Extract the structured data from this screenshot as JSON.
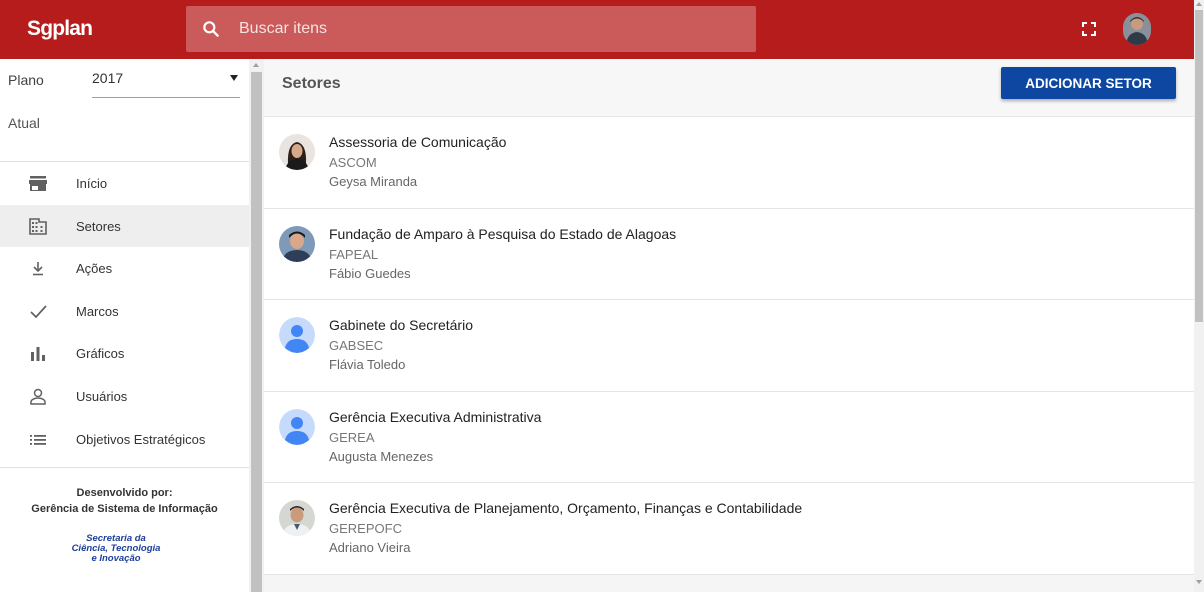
{
  "app": {
    "brand": "Sgplan"
  },
  "search": {
    "placeholder": "Buscar itens",
    "value": ""
  },
  "colors": {
    "topbar": "#b71c1c",
    "primary_button": "#0d47a1",
    "active_nav": "#eeeeee"
  },
  "icons": {
    "search": "search-icon",
    "fullscreen": "fullscreen-icon",
    "user": "user-avatar"
  },
  "sidebar": {
    "plan_label": "Plano",
    "plan_value": "2017",
    "atual_label": "Atual",
    "items": [
      {
        "label": "Início",
        "icon": "store-icon",
        "active": false
      },
      {
        "label": "Setores",
        "icon": "domain-icon",
        "active": true
      },
      {
        "label": "Ações",
        "icon": "download-icon",
        "active": false
      },
      {
        "label": "Marcos",
        "icon": "check-icon",
        "active": false
      },
      {
        "label": "Gráficos",
        "icon": "bar-chart-icon",
        "active": false
      },
      {
        "label": "Usuários",
        "icon": "person-icon",
        "active": false
      },
      {
        "label": "Objetivos Estratégicos",
        "icon": "list-icon",
        "active": false
      }
    ],
    "footer": {
      "developed_by": "Desenvolvido por:",
      "org": "Gerência de Sistema de Informação",
      "logo_line1": "Secretaria da",
      "logo_line2": "Ciência, Tecnologia",
      "logo_line3": "e Inovação"
    }
  },
  "main": {
    "title": "Setores",
    "add_button": "ADICIONAR SETOR",
    "sectors": [
      {
        "name": "Assessoria de Comunicação",
        "acronym": "ASCOM",
        "responsible": "Geysa Miranda",
        "avatar": "photo-woman"
      },
      {
        "name": "Fundação de Amparo à Pesquisa do Estado de Alagoas",
        "acronym": "FAPEAL",
        "responsible": "Fábio Guedes",
        "avatar": "photo-man"
      },
      {
        "name": "Gabinete do Secretário",
        "acronym": "GABSEC",
        "responsible": "Flávia Toledo",
        "avatar": "default-avatar"
      },
      {
        "name": "Gerência Executiva Administrativa",
        "acronym": "GEREA",
        "responsible": "Augusta Menezes",
        "avatar": "default-avatar"
      },
      {
        "name": "Gerência Executiva de Planejamento, Orçamento, Finanças e Contabilidade",
        "acronym": "GEREPOFC",
        "responsible": "Adriano Vieira",
        "avatar": "photo-man-2"
      }
    ]
  }
}
